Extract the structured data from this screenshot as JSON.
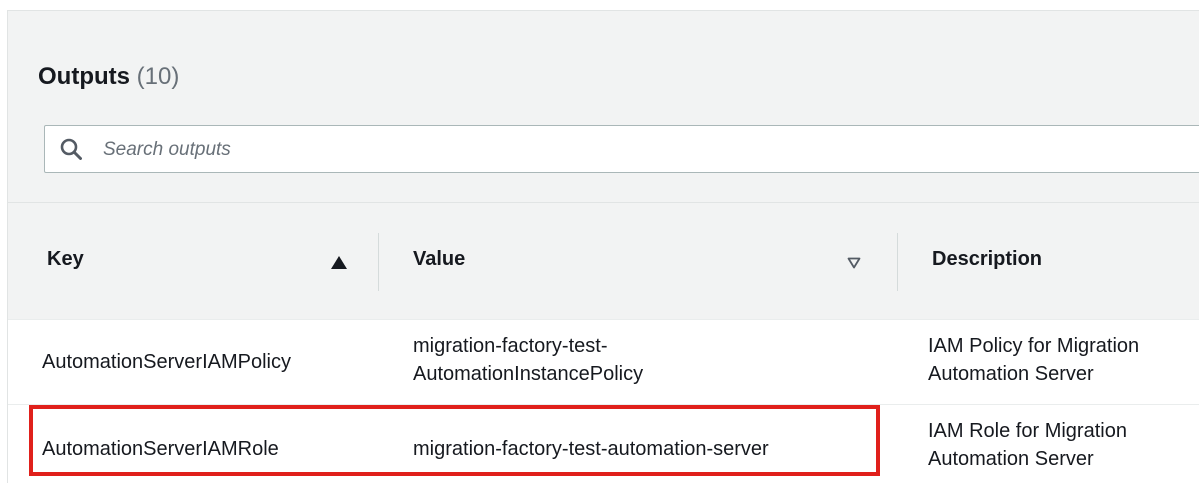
{
  "outputs_panel": {
    "title": "Outputs",
    "count": "(10)",
    "search": {
      "placeholder": "Search outputs",
      "icon": "search-icon"
    },
    "columns": [
      {
        "label": "Key",
        "sort": "ascending",
        "icon": "sort-ascending-icon"
      },
      {
        "label": "Value",
        "sort": "none",
        "icon": "sort-descending-outline-icon"
      },
      {
        "label": "Description"
      }
    ],
    "rows": [
      {
        "key": "AutomationServerIAMPolicy",
        "value_line1": "migration-factory-test-",
        "value_line2": "AutomationInstancePolicy",
        "description_line1": "IAM Policy for Migration",
        "description_line2": "Automation Server"
      },
      {
        "key": "AutomationServerIAMRole",
        "value_line1": "migration-factory-test-automation-server",
        "description_line1": "IAM Role for Migration",
        "description_line2": "Automation Server"
      }
    ],
    "highlight_color": "#e0201b"
  }
}
